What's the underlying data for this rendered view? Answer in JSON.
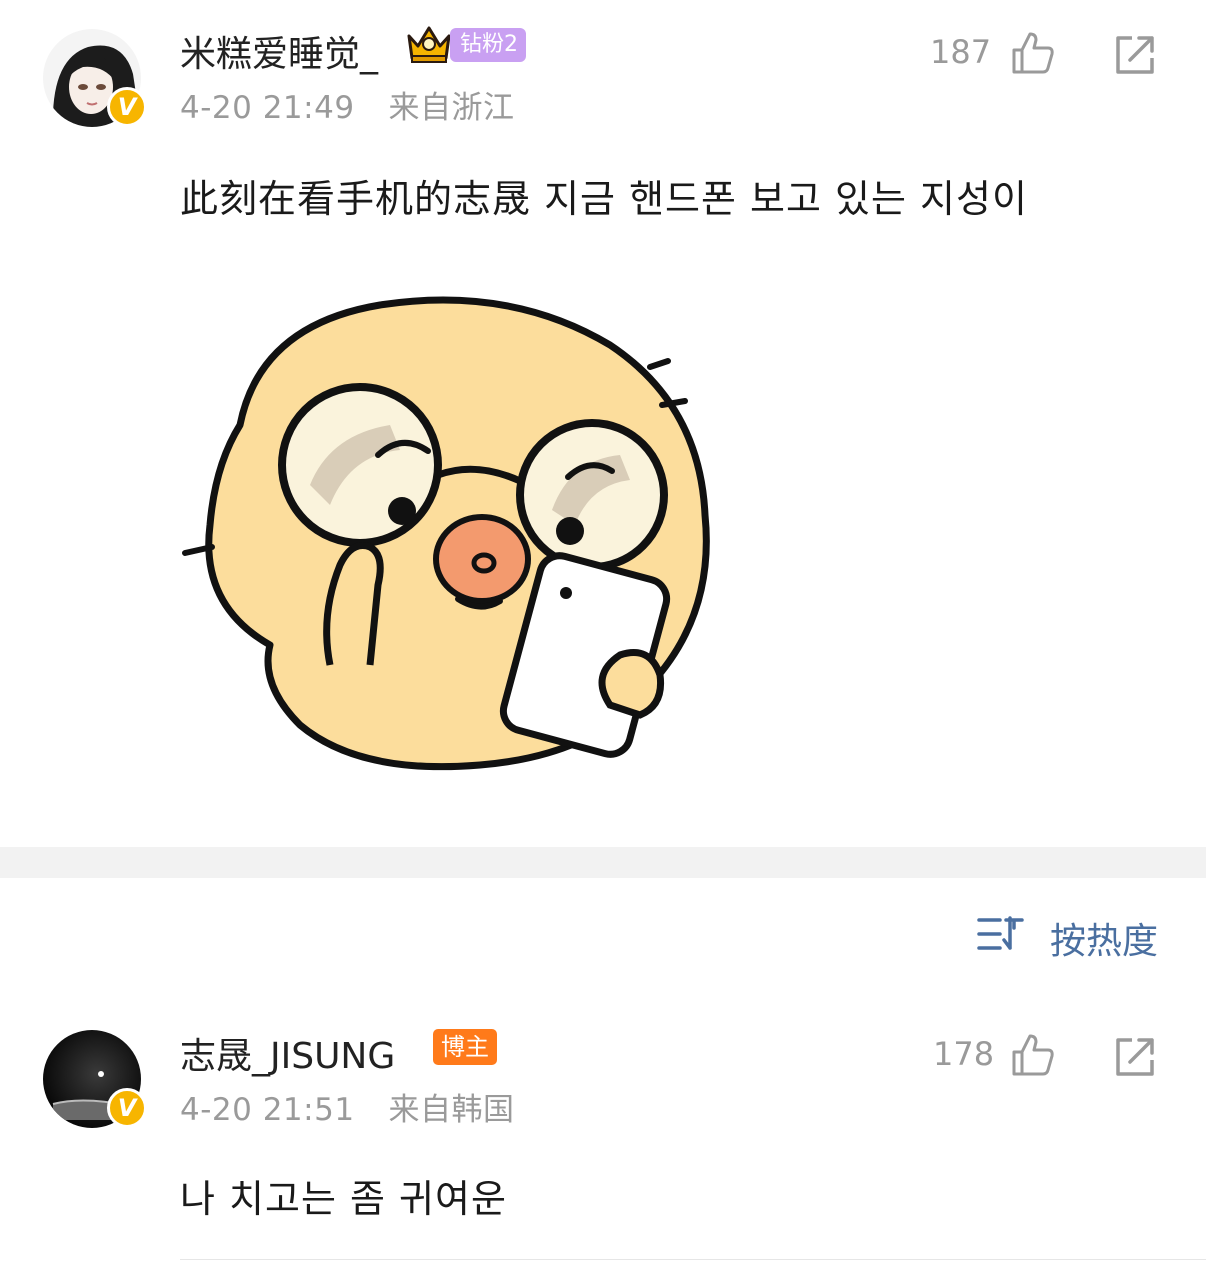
{
  "post": {
    "author": "米糕爱睡觉_",
    "fan_badge": "钻粉2",
    "time": "4-20 21:49",
    "location": "来自浙江",
    "likes": "187",
    "text": "此刻在看手机的志晟 지금 핸드폰 보고 있는 지성이",
    "verified_mark": "V",
    "sticker": "cartoon-chick-glasses-looking-at-phone"
  },
  "sort": {
    "icon": "sort-icon",
    "label": "按热度"
  },
  "comment": {
    "author": "志晟_JISUNG",
    "role_badge": "博主",
    "time": "4-20 21:51",
    "location": "来自韩国",
    "likes": "178",
    "text": "나 치고는 좀 귀여운",
    "verified_mark": "V"
  },
  "colors": {
    "verified": "#f7b500",
    "fan_badge": "#c9a0f2",
    "host_badge": "#ff7a1a",
    "link": "#4a6fa0",
    "meta": "#9a9a9a"
  }
}
